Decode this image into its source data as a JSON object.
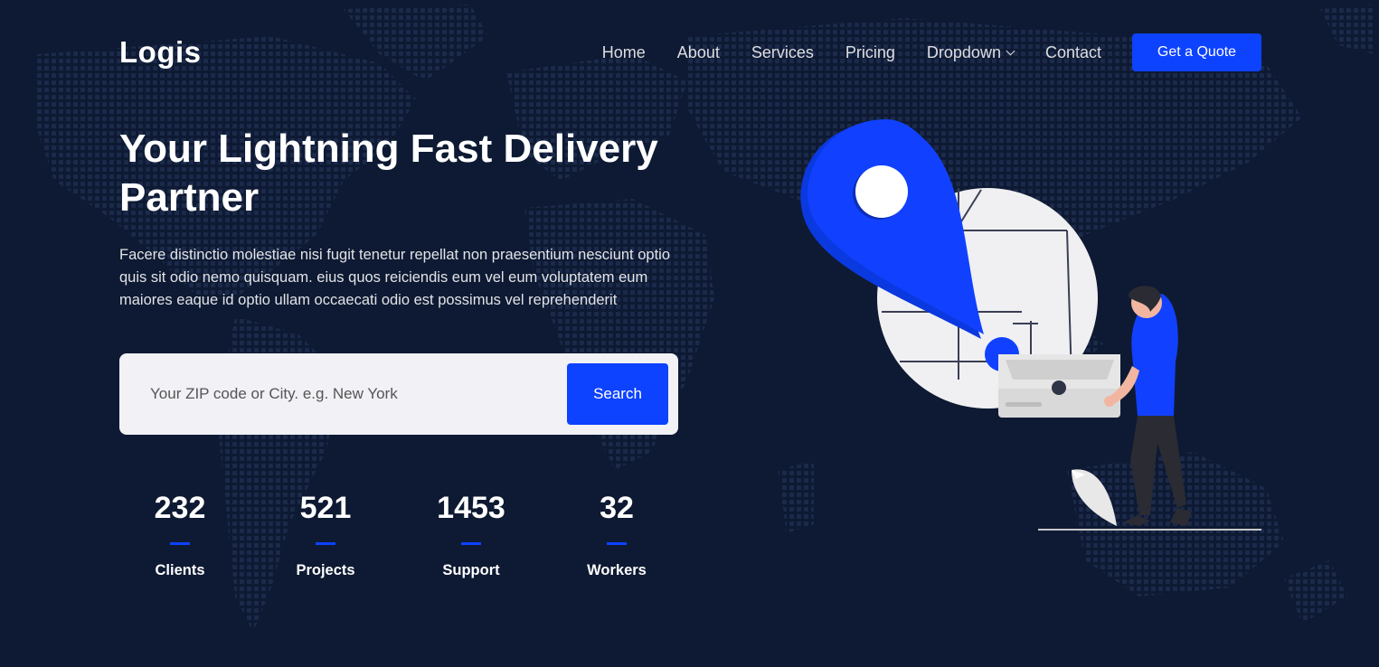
{
  "header": {
    "logo": "Logis",
    "nav": [
      "Home",
      "About",
      "Services",
      "Pricing",
      "Dropdown",
      "Contact"
    ],
    "cta": "Get a Quote"
  },
  "hero": {
    "title": "Your Lightning Fast Delivery Partner",
    "text": "Facere distinctio molestiae nisi fugit tenetur repellat non praesentium nesciunt optio quis sit odio nemo quisquam. eius quos reiciendis eum vel eum voluptatem eum maiores eaque id optio ullam occaecati odio est possimus vel reprehenderit"
  },
  "search": {
    "placeholder": "Your ZIP code or City. e.g. New York",
    "button": "Search"
  },
  "stats": [
    {
      "value": "232",
      "label": "Clients"
    },
    {
      "value": "521",
      "label": "Projects"
    },
    {
      "value": "1453",
      "label": "Support"
    },
    {
      "value": "32",
      "label": "Workers"
    }
  ],
  "colors": {
    "background": "#0e1a33",
    "accent": "#0d42ff",
    "search_bg": "#f1f1f6"
  },
  "icons": {
    "dropdown": "chevron-down-icon",
    "illustration": "delivery-location-pin-illustration"
  }
}
